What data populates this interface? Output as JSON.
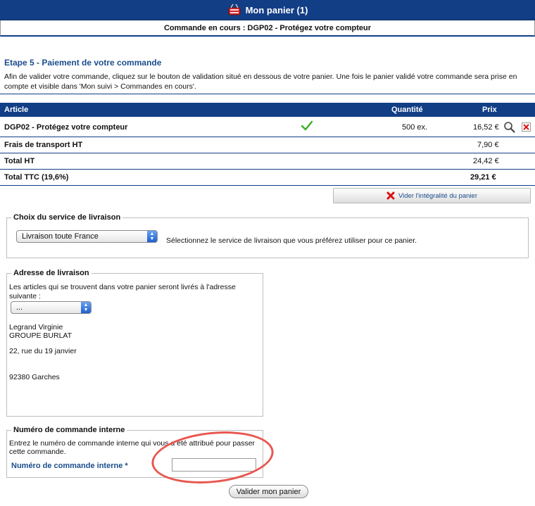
{
  "header": {
    "title": "Mon panier (1)",
    "icon": "basket-icon"
  },
  "subheader": {
    "text": "Commande en cours : DGP02 - Protégez votre compteur"
  },
  "step": {
    "title": "Etape 5 - Paiement de votre commande",
    "intro": "Afin de valider votre commande, cliquez sur le bouton de validation situé en dessous de votre panier. Une fois le panier validé votre commande sera prise en compte et visible dans 'Mon suivi > Commandes en cours'."
  },
  "table": {
    "headers": {
      "article": "Article",
      "quantity": "Quantité",
      "price": "Prix"
    },
    "item": {
      "name": "DGP02 - Protégez votre compteur",
      "quantity": "500 ex.",
      "price": "16,52 €"
    },
    "transport": {
      "label": "Frais de transport HT",
      "value": "7,90 €"
    },
    "total_ht": {
      "label": "Total HT",
      "value": "24,42 €"
    },
    "total_ttc": {
      "label": "Total TTC (19,6%)",
      "value": "29,21 €"
    }
  },
  "empty_cart_label": "Vider l'intégralité du panier",
  "delivery_service": {
    "legend": "Choix du service de livraison",
    "selected": "Livraison toute France",
    "hint": "Sélectionnez le service de livraison que vous préférez utiliser pour ce panier."
  },
  "address": {
    "legend": "Adresse de livraison",
    "intro": "Les articles qui se trouvent dans votre panier seront livrés à l'adresse suivante :",
    "selected": "...",
    "name": "Legrand Virginie",
    "company": "GROUPE BURLAT",
    "street": "22, rue du 19 janvier",
    "city": "92380 Garches"
  },
  "internal_order": {
    "legend": "Numéro de commande interne",
    "intro_line1": "Entrez le numéro de commande interne qui vous a été attribué pour passer",
    "intro_line2": "cette commande.",
    "field_label": "Numéro de commande interne *",
    "value": ""
  },
  "submit_label": "Valider mon panier",
  "colors": {
    "header_bg": "#123e86",
    "accent_text": "#1b4d8c",
    "annotation": "#e8574f"
  }
}
